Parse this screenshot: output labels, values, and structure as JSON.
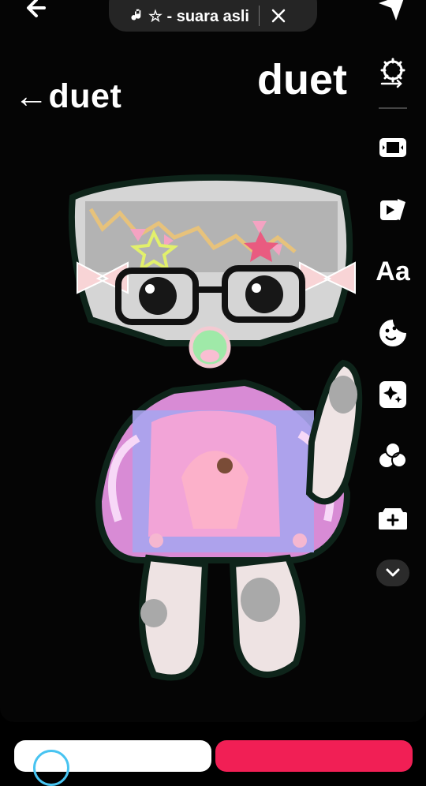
{
  "header": {
    "back_icon": "back-arrow-icon",
    "sound_label": "☆ - suara asli",
    "note_icon": "music-note-icon",
    "close_icon": "close-icon",
    "send_icon": "send-icon"
  },
  "overlay_text": {
    "left": "←duet",
    "right": "duet"
  },
  "toolbar": {
    "icons": [
      "settings-icon",
      "flip-layout-icon",
      "template-icon",
      "text-icon",
      "sticker-icon",
      "effects-icon",
      "filters-icon",
      "add-clip-icon",
      "expand-more-icon"
    ],
    "text_label": "Aa"
  },
  "colors": {
    "primary": "#f11f55",
    "panel": "#2b2b2b",
    "accent_blue": "#48c4f1"
  }
}
